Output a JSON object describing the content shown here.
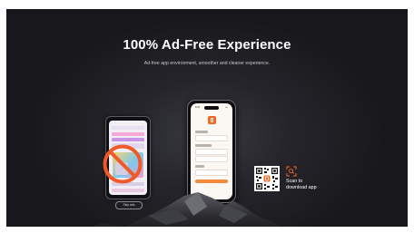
{
  "hero": {
    "title": "100% Ad-Free Experience",
    "subtitle": "Ad-free app environment, smoother and cleaner experience."
  },
  "left_phone": {
    "skip_label": "Skip ads"
  },
  "center_phone": {
    "status_time": "9:41",
    "status_icons": "•••"
  },
  "qr": {
    "caption_line1": "Scan to",
    "caption_line2": "download app"
  },
  "colors": {
    "background": "#1e1e23",
    "accent": "#f06a25",
    "no_sign": "#f05a28"
  },
  "icons": [
    "app-logo-icon",
    "scan-icon",
    "no-ads-icon"
  ]
}
